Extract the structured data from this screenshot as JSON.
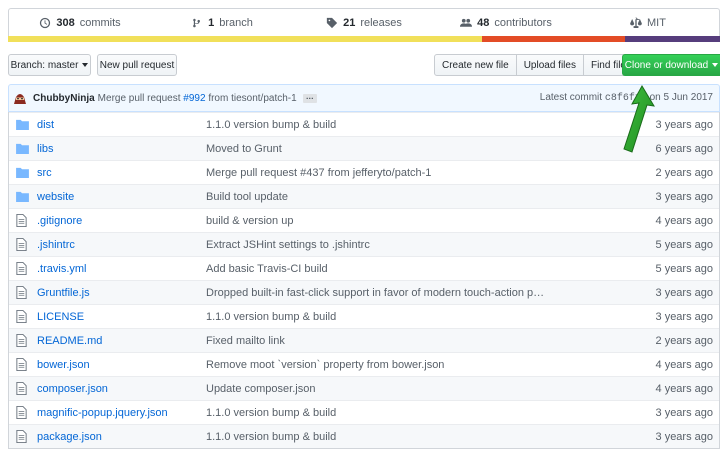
{
  "stats": {
    "commits_count": "308",
    "commits_label": "commits",
    "branches_count": "1",
    "branches_label": "branch",
    "releases_count": "21",
    "releases_label": "releases",
    "contributors_count": "48",
    "contributors_label": "contributors",
    "license": "MIT"
  },
  "language_colors": [
    "#f1e05a",
    "#e34c26",
    "#563d7c"
  ],
  "toolbar": {
    "branch_label": "Branch: master",
    "new_pr_label": "New pull request",
    "create_file_label": "Create new file",
    "upload_files_label": "Upload files",
    "find_file_label": "Find file",
    "clone_label": "Clone or download"
  },
  "commit": {
    "author": "ChubbyNinja",
    "msg_prefix": "Merge pull request",
    "pr": "#992",
    "msg_suffix": "from tiesont/patch-1",
    "ellipsis": "…",
    "latest_label": "Latest commit",
    "sha": "c8f6f15",
    "date": "on 5 Jun 2017"
  },
  "accent_colors": {
    "link": "#0366d6",
    "clone_green": "#28a745",
    "arrow_green": "#2e9e2e"
  },
  "files": [
    {
      "type": "dir",
      "name": "dist",
      "message": "1.1.0 version bump & build",
      "age": "3 years ago"
    },
    {
      "type": "dir",
      "name": "libs",
      "message": "Moved to Grunt",
      "age": "6 years ago"
    },
    {
      "type": "dir",
      "name": "src",
      "message": "Merge pull request #437 from jefferyto/patch-1",
      "age": "2 years ago"
    },
    {
      "type": "dir",
      "name": "website",
      "message": "Build tool update",
      "age": "3 years ago"
    },
    {
      "type": "file",
      "name": ".gitignore",
      "message": "build & version up",
      "age": "4 years ago"
    },
    {
      "type": "file",
      "name": ".jshintrc",
      "message": "Extract JSHint settings to .jshintrc",
      "age": "5 years ago"
    },
    {
      "type": "file",
      "name": ".travis.yml",
      "message": "Add basic Travis-CI build",
      "age": "5 years ago"
    },
    {
      "type": "file",
      "name": "Gruntfile.js",
      "message": "Dropped built-in fast-click support in favor of modern touch-action p…",
      "age": "3 years ago"
    },
    {
      "type": "file",
      "name": "LICENSE",
      "message": "1.1.0 version bump & build",
      "age": "3 years ago"
    },
    {
      "type": "file",
      "name": "README.md",
      "message": "Fixed mailto link",
      "age": "2 years ago"
    },
    {
      "type": "file",
      "name": "bower.json",
      "message": "Remove moot `version` property from bower.json",
      "age": "4 years ago"
    },
    {
      "type": "file",
      "name": "composer.json",
      "message": "Update composer.json",
      "age": "4 years ago"
    },
    {
      "type": "file",
      "name": "magnific-popup.jquery.json",
      "message": "1.1.0 version bump & build",
      "age": "3 years ago"
    },
    {
      "type": "file",
      "name": "package.json",
      "message": "1.1.0 version bump & build",
      "age": "3 years ago"
    }
  ]
}
